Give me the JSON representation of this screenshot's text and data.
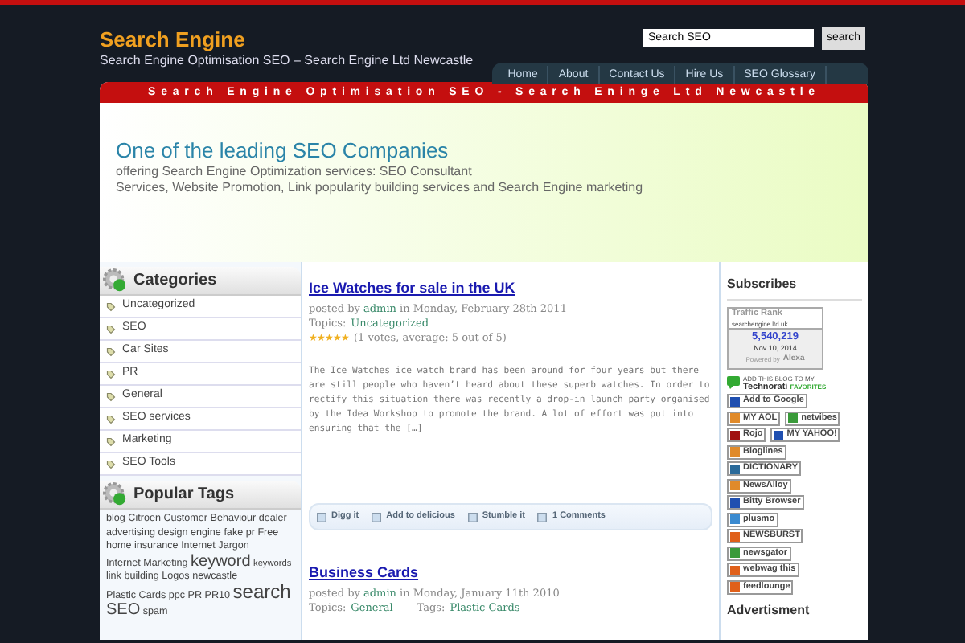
{
  "site": {
    "title": "Search Engine",
    "tagline": "Search Engine Optimisation SEO – Search Engine Ltd Newcastle"
  },
  "search": {
    "value": "Search SEO",
    "button": "search"
  },
  "nav": [
    {
      "label": "Home"
    },
    {
      "label": "About"
    },
    {
      "label": "Contact Us"
    },
    {
      "label": "Hire Us"
    },
    {
      "label": "SEO Glossary"
    }
  ],
  "banner": {
    "strip": "Search Engine Optimisation SEO - Search Eninge Ltd Newcastle",
    "headline": "One of the leading SEO Companies",
    "lines": [
      "offering Search Engine Optimization services: SEO Consultant",
      "Services, Website Promotion, Link popularity building services and Search Engine marketing"
    ]
  },
  "categories": {
    "title": "Categories",
    "items": [
      "Uncategorized",
      "SEO",
      "Car Sites",
      "PR",
      "General",
      "SEO services",
      "Marketing",
      "SEO Tools"
    ]
  },
  "popular_tags": {
    "title": "Popular Tags",
    "tags": [
      {
        "label": "blog",
        "kind": "small"
      },
      {
        "label": "Citroen",
        "kind": "small"
      },
      {
        "label": "Customer Behaviour",
        "kind": "small"
      },
      {
        "label": "dealer",
        "kind": "small"
      },
      {
        "label": "advertising",
        "kind": "small"
      },
      {
        "label": "design",
        "kind": "small"
      },
      {
        "label": "engine",
        "kind": "small"
      },
      {
        "label": "fake pr",
        "kind": "small"
      },
      {
        "label": "Free",
        "kind": "small"
      },
      {
        "label": "home insurance",
        "kind": "small"
      },
      {
        "label": "Internet Jargon",
        "kind": "small"
      },
      {
        "label": "Internet Marketing",
        "kind": "small"
      },
      {
        "label": "keyword",
        "kind": "large"
      },
      {
        "label": "keywords",
        "kind": "tiny"
      },
      {
        "label": "link building",
        "kind": "small"
      },
      {
        "label": "Logos",
        "kind": "small"
      },
      {
        "label": "newcastle",
        "kind": "small"
      },
      {
        "label": "Plastic Cards",
        "kind": "small"
      },
      {
        "label": "ppc",
        "kind": "small"
      },
      {
        "label": "PR",
        "kind": "small"
      },
      {
        "label": "PR10",
        "kind": "small"
      },
      {
        "label": "search",
        "kind": "huge"
      },
      {
        "label": "SEO",
        "kind": "large"
      },
      {
        "label": "spam",
        "kind": "small"
      }
    ]
  },
  "posts": [
    {
      "title": "Ice Watches for sale in the UK",
      "posted_by": "posted by",
      "author": "admin",
      "date": "in Monday, February 28th 2011",
      "topics_label": "Topics:",
      "topic": "Uncategorized",
      "stars": 5,
      "votes": "(1 votes, average: 5 out of 5)",
      "excerpt": "The Ice Watches ice watch brand has been around for four years but there are still people who haven’t heard about these superb watches. In order to rectify this situation there was recently a drop-in launch party organised by the Idea Workshop to promote the brand. A lot of effort was put into ensuring that the […]",
      "actions": [
        "Digg it",
        "Add to delicious",
        "Stumble it",
        "1 Comments"
      ]
    },
    {
      "title": "Business Cards",
      "posted_by": "posted by",
      "author": "admin",
      "date": "in Monday, January 11th 2010",
      "topics_label": "Topics:",
      "topic": "General",
      "tags_label": "Tags:",
      "tag": "Plastic Cards"
    }
  ],
  "subscribes": {
    "title": "Subscribes",
    "traffic": {
      "title": "Traffic Rank",
      "site": "searchengine.ltd.uk",
      "rank": "5,540,219",
      "date": "Nov 10, 2014",
      "powered": "Powered by",
      "brand": "Alexa"
    },
    "technorati": {
      "top": "ADD THIS BLOG TO MY",
      "main": "Technorati",
      "accent": "FAVORITES"
    },
    "rows": [
      [
        {
          "label": "Add to Google",
          "color": "#1f4fb0"
        }
      ],
      [
        {
          "label": "MY AOL",
          "color": "#e08a2a"
        },
        {
          "label": "netvibes",
          "color": "#3a9a3a"
        }
      ],
      [
        {
          "label": "Rojo",
          "color": "#a01010"
        },
        {
          "label": "MY YAHOO!",
          "color": "#1f4fb0"
        }
      ],
      [
        {
          "label": "Bloglines",
          "color": "#e08a2a"
        }
      ],
      [
        {
          "label": "DICTIONARY",
          "color": "#2a6a9a"
        }
      ],
      [
        {
          "label": "NewsAlloy",
          "color": "#e08a2a"
        }
      ],
      [
        {
          "label": "Bitty Browser",
          "color": "#1f4fb0"
        }
      ],
      [
        {
          "label": "plusmo",
          "color": "#3a8ad0"
        }
      ],
      [
        {
          "label": "NEWSBURST",
          "color": "#e0601a"
        }
      ],
      [
        {
          "label": "newsgator",
          "color": "#3a9a3a"
        }
      ],
      [
        {
          "label": "webwag this",
          "color": "#e0601a"
        }
      ],
      [
        {
          "label": "feedlounge",
          "color": "#e0601a"
        }
      ]
    ]
  },
  "advertisment": {
    "title": "Advertisment"
  }
}
